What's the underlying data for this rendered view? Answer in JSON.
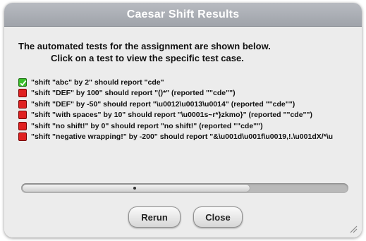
{
  "dialog": {
    "title": "Caesar Shift Results",
    "intro_line1": "The automated tests for the assignment are shown below.",
    "intro_line2": "Click on a test to view the specific test case."
  },
  "tests": [
    {
      "status": "pass",
      "label": "\"shift \"abc\" by 2\" should report \"cde\""
    },
    {
      "status": "fail",
      "label": "\"shift \"DEF\" by 100\" should report \"()*\" (reported \"\"cde\"\")"
    },
    {
      "status": "fail",
      "label": "\"shift \"DEF\" by -50\" should report \"\\u0012\\u0013\\u0014\" (reported \"\"cde\"\")"
    },
    {
      "status": "fail",
      "label": "\"shift \"with spaces\" by 10\" should report \"\\u0001s~r*}zkmo}\" (reported \"\"cde\"\")"
    },
    {
      "status": "fail",
      "label": "\"shift \"no shift!\" by 0\" should report \"no shift!\" (reported \"\"cde\"\")"
    },
    {
      "status": "fail",
      "label": "\"shift \"negative wrapping!\" by -200\" should report \"&\\u001d\\u001f\\u0019,!.\\u001dX/*\\u"
    }
  ],
  "scrollbar": {
    "position_fraction": 0.0,
    "visible_fraction": 0.69
  },
  "buttons": {
    "rerun": "Rerun",
    "close": "Close"
  },
  "colors": {
    "pass": "#3bbf2a",
    "fail": "#e02020",
    "titlebar": "#a9adb3"
  },
  "icons": {
    "pass": "checkmark-icon",
    "fail": "fail-square-icon",
    "resize": "resize-grip-icon"
  }
}
